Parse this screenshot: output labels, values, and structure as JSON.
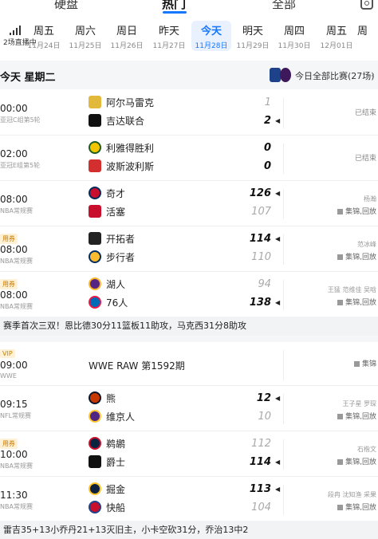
{
  "top_tabs": [
    "硬盘",
    "热门",
    "全部"
  ],
  "date_bar": {
    "live_label": "2场直播中",
    "days": [
      {
        "w": "周五",
        "d": "11月24日"
      },
      {
        "w": "周六",
        "d": "11月25日"
      },
      {
        "w": "周日",
        "d": "11月26日"
      },
      {
        "w": "昨天",
        "d": "11月27日"
      },
      {
        "w": "今天",
        "d": "11月28日"
      },
      {
        "w": "明天",
        "d": "11月29日"
      },
      {
        "w": "周四",
        "d": "11月30日"
      },
      {
        "w": "周五",
        "d": "12月01日"
      },
      {
        "w": "周",
        "d": ""
      }
    ]
  },
  "header": {
    "date": "今天 星期二",
    "all_matches": "今日全部比赛(27场)"
  },
  "matches": [
    {
      "time": "00:00",
      "league": "亚冠C组第5轮",
      "tag": "",
      "team1": "阿尔马雷克",
      "score1": "1",
      "team2": "吉达联合",
      "score2": "2",
      "status": "已结束",
      "extra1": "",
      "extra2": ""
    },
    {
      "time": "02:00",
      "league": "亚冠E组第5轮",
      "tag": "",
      "team1": "利雅得胜利",
      "score1": "0",
      "team2": "波斯波利斯",
      "score2": "0",
      "status": "已结束",
      "extra1": "",
      "extra2": ""
    },
    {
      "time": "08:00",
      "league": "NBA常规赛",
      "tag": "",
      "team1": "奇才",
      "score1": "126",
      "team2": "活塞",
      "score2": "107",
      "status": "",
      "extra1": "杨瀚",
      "extra2": "集锦,回放"
    },
    {
      "time": "08:00",
      "league": "NBA常规赛",
      "tag": "用券",
      "team1": "开拓者",
      "score1": "114",
      "team2": "步行者",
      "score2": "110",
      "status": "",
      "extra1": "范冰峰",
      "extra2": "集锦,回放"
    },
    {
      "time": "08:00",
      "league": "NBA常规赛",
      "tag": "用券",
      "team1": "湖人",
      "score1": "94",
      "team2": "76人",
      "score2": "138",
      "status": "",
      "extra1": "王猛 范维佳 吴晗",
      "extra2": "集锦,回放"
    },
    {
      "time": "09:00",
      "league": "WWE",
      "tag": "VIP",
      "title": "WWE RAW 第1592期",
      "status": "",
      "extra1": "",
      "extra2": "集锦"
    },
    {
      "time": "09:15",
      "league": "NFL常规赛",
      "tag": "",
      "team1": "熊",
      "score1": "12",
      "team2": "维京人",
      "score2": "10",
      "status": "",
      "extra1": "王子星 罗琛",
      "extra2": "集锦,回放"
    },
    {
      "time": "10:00",
      "league": "NBA常规赛",
      "tag": "用券",
      "team1": "鹈鹕",
      "score1": "112",
      "team2": "爵士",
      "score2": "114",
      "status": "",
      "extra1": "石楷文",
      "extra2": "集锦,回放"
    },
    {
      "time": "11:30",
      "league": "NBA常规赛",
      "tag": "",
      "team1": "掘金",
      "score1": "113",
      "team2": "快船",
      "score2": "104",
      "status": "",
      "extra1": "段冉 沈知渔 采果",
      "extra2": "集锦,回放"
    }
  ],
  "news": [
    "赛季首次三双！恩比德30分11篮板11助攻，马克西31分8助攻",
    "雷吉35+13小乔丹21+13灭旧主，小卡空砍31分，乔治13中2"
  ],
  "colors": {
    "accent": "#1677ff",
    "winner": "#111111",
    "loser": "#aaaaaa"
  }
}
